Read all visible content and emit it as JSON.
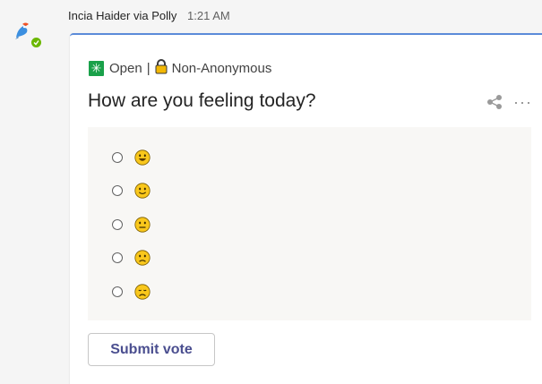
{
  "message": {
    "sender": "Incia Haider via Polly",
    "time": "1:21 AM"
  },
  "card": {
    "status": "Open",
    "separator": "|",
    "visibility": "Non-Anonymous",
    "question": "How are you feeling today?",
    "options": [
      {
        "icon": "very-happy-emoji-icon"
      },
      {
        "icon": "happy-emoji-icon"
      },
      {
        "icon": "neutral-emoji-icon"
      },
      {
        "icon": "sad-emoji-icon"
      },
      {
        "icon": "very-sad-emoji-icon"
      }
    ],
    "submit_label": "Submit vote"
  },
  "colors": {
    "accent": "#5b8bd9",
    "open_badge": "#1aa14a",
    "submit_text": "#4a4e8f",
    "presence": "#6bb700"
  }
}
